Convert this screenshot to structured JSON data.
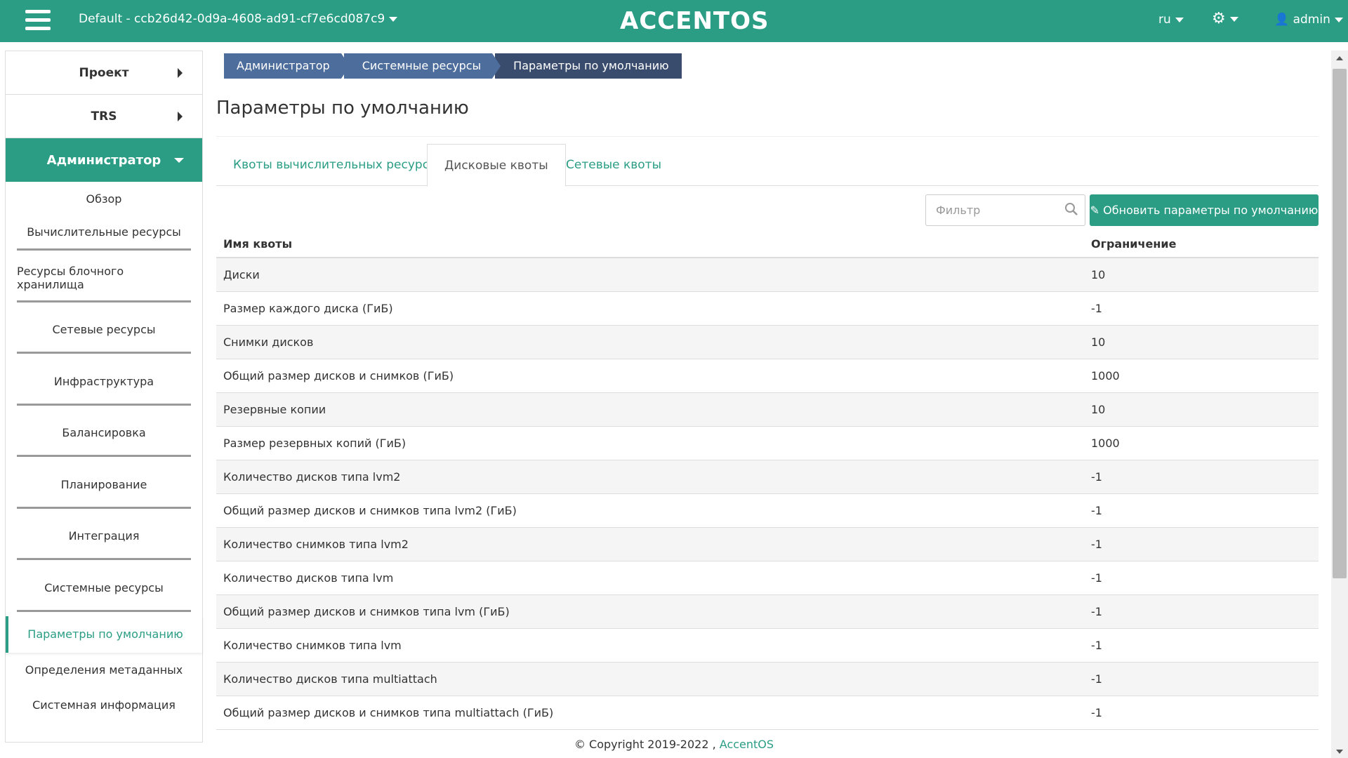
{
  "header": {
    "project_label": "Default - ccb26d42-0d9a-4608-ad91-cf7e6cd087c9",
    "logo": "ACCENTOS",
    "lang": "ru",
    "user": "admin",
    "icons": [
      "menu-icon",
      "gear-icon",
      "user-icon",
      "chevron-down-icon"
    ]
  },
  "sidebar": {
    "top_items": [
      {
        "label": "Проект"
      },
      {
        "label": "TRS"
      }
    ],
    "admin_label": "Администратор",
    "sub_items": [
      {
        "label": "Обзор"
      },
      {
        "label": "Вычислительные ресурсы"
      },
      {
        "label": "Ресурсы блочного хранилища"
      },
      {
        "label": "Сетевые ресурсы"
      },
      {
        "label": "Инфраструктура"
      },
      {
        "label": "Балансировка"
      },
      {
        "label": "Планирование"
      },
      {
        "label": "Интеграция"
      },
      {
        "label": "Системные ресурсы"
      }
    ],
    "active_item": "Параметры по умолчанию",
    "bottom_items": [
      {
        "label": "Определения метаданных"
      },
      {
        "label": "Системная информация"
      }
    ]
  },
  "breadcrumb": [
    "Администратор",
    "Системные ресурсы",
    "Параметры по умолчанию"
  ],
  "page_title": "Параметры по умолчанию",
  "tabs": [
    {
      "label": "Квоты вычислительных ресурсов",
      "active": false
    },
    {
      "label": "Дисковые квоты",
      "active": true
    },
    {
      "label": "Сетевые квоты",
      "active": false
    }
  ],
  "toolbar": {
    "filter_placeholder": "Фильтр",
    "update_button": "Обновить параметры по умолчанию"
  },
  "table": {
    "columns": [
      "Имя квоты",
      "Ограничение"
    ],
    "rows": [
      {
        "name": "Диски",
        "value": "10"
      },
      {
        "name": "Размер каждого диска (ГиБ)",
        "value": "-1"
      },
      {
        "name": "Снимки дисков",
        "value": "10"
      },
      {
        "name": "Общий размер дисков и снимков (ГиБ)",
        "value": "1000"
      },
      {
        "name": "Резервные копии",
        "value": "10"
      },
      {
        "name": "Размер резервных копий (ГиБ)",
        "value": "1000"
      },
      {
        "name": "Количество дисков типа lvm2",
        "value": "-1"
      },
      {
        "name": "Общий размер дисков и снимков типа lvm2 (ГиБ)",
        "value": "-1"
      },
      {
        "name": "Количество снимков типа lvm2",
        "value": "-1"
      },
      {
        "name": "Количество дисков типа lvm",
        "value": "-1"
      },
      {
        "name": "Общий размер дисков и снимков типа lvm (ГиБ)",
        "value": "-1"
      },
      {
        "name": "Количество снимков типа lvm",
        "value": "-1"
      },
      {
        "name": "Количество дисков типа multiattach",
        "value": "-1"
      },
      {
        "name": "Общий размер дисков и снимков типа multiattach (ГиБ)",
        "value": "-1"
      }
    ]
  },
  "footer": {
    "copyright": "© Copyright 2019-2022 , ",
    "link": "AccentOS"
  },
  "colors": {
    "accent": "#2a9d84",
    "breadcrumb": "#4d6e9c",
    "breadcrumb_active": "#394c6e"
  }
}
